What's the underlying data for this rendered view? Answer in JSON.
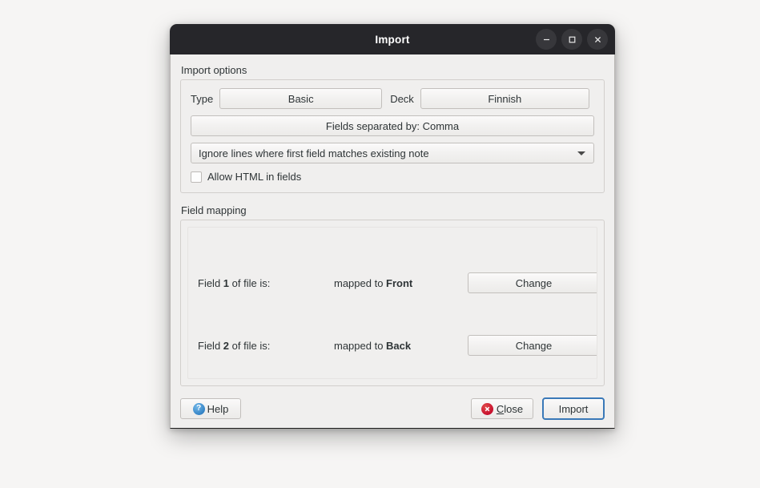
{
  "window": {
    "title": "Import",
    "controls": {
      "minimize": "minimize-icon",
      "maximize": "maximize-icon",
      "close": "close-icon"
    }
  },
  "import_options": {
    "group_label": "Import options",
    "type_label": "Type",
    "type_value": "Basic",
    "deck_label": "Deck",
    "deck_value": "Finnish",
    "separator_button": "Fields separated by: Comma",
    "duplicate_mode": "Ignore lines where first field matches existing note",
    "allow_html_label": "Allow HTML in fields",
    "allow_html_checked": false
  },
  "field_mapping": {
    "group_label": "Field mapping",
    "rows": [
      {
        "field_prefix": "Field ",
        "field_number": "1",
        "field_suffix": " of file is:",
        "mapped_prefix": "mapped to ",
        "mapped_target": "Front",
        "change_label": "Change"
      },
      {
        "field_prefix": "Field ",
        "field_number": "2",
        "field_suffix": " of file is:",
        "mapped_prefix": "mapped to ",
        "mapped_target": "Back",
        "change_label": "Change"
      }
    ]
  },
  "footer": {
    "help_label": "Help",
    "help_icon": "question-circle-icon",
    "close_mnemonic": "C",
    "close_rest": "lose",
    "close_icon": "error-circle-icon",
    "import_label": "Import"
  },
  "colors": {
    "titlebar_bg": "#26262a",
    "window_bg": "#f0efee",
    "accent_focus": "#3a79b8",
    "close_icon_red": "#c8102e",
    "help_icon_blue": "#3584c6"
  }
}
